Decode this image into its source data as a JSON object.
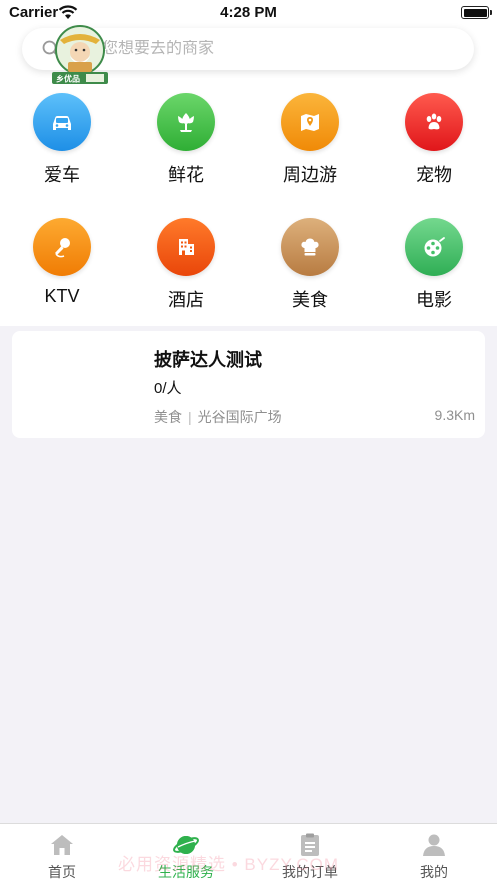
{
  "status": {
    "carrier": "Carrier",
    "time": "4:28 PM"
  },
  "search": {
    "placeholder": "搜索您想要去的商家"
  },
  "categories": [
    {
      "label": "爱车",
      "icon": "car-icon",
      "color": "#2fa2ef"
    },
    {
      "label": "鲜花",
      "icon": "flower-icon",
      "color": "#3fbf45"
    },
    {
      "label": "周边游",
      "icon": "map-icon",
      "color": "#f39712"
    },
    {
      "label": "宠物",
      "icon": "paw-icon",
      "color": "#ee2a2a"
    },
    {
      "label": "KTV",
      "icon": "microphone-icon",
      "color": "#f68e0e"
    },
    {
      "label": "酒店",
      "icon": "building-icon",
      "color": "#f25a12"
    },
    {
      "label": "美食",
      "icon": "chef-hat-icon",
      "color": "#c8935a"
    },
    {
      "label": "电影",
      "icon": "film-reel-icon",
      "color": "#46c06a"
    }
  ],
  "listing": {
    "title": "披萨达人测试",
    "count": "0/人",
    "category": "美食",
    "separator": "|",
    "address": "光谷国际广场",
    "distance": "9.3Km",
    "logo_text": "乡优品"
  },
  "tabs": [
    {
      "label": "首页",
      "icon": "home-icon",
      "active": false
    },
    {
      "label": "生活服务",
      "icon": "planet-icon",
      "active": true
    },
    {
      "label": "我的订单",
      "icon": "clipboard-icon",
      "active": false
    },
    {
      "label": "我的",
      "icon": "user-icon",
      "active": false
    }
  ],
  "watermark": "必用资源精选 • BYZY.COM",
  "colors": {
    "accent_green": "#2fb14d",
    "background": "#f3f2f7"
  }
}
